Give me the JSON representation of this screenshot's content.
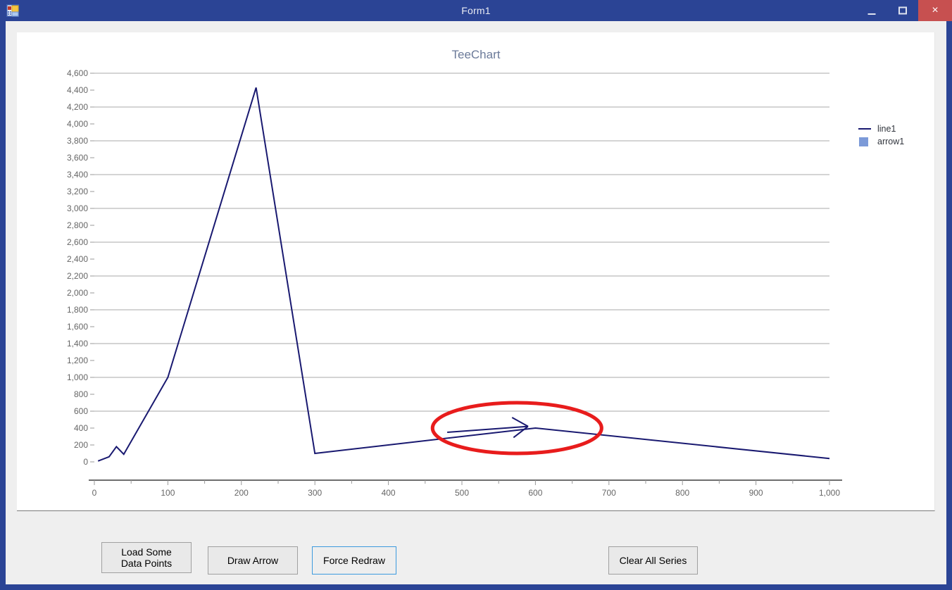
{
  "window": {
    "title": "Form1",
    "icon": "form-designer-icon",
    "minimize_label": "–",
    "maximize_label": "❐",
    "close_label": "×",
    "border_color": "#2b4495",
    "close_color": "#c75050"
  },
  "chart": {
    "title": "TeeChart",
    "title_color": "#6b7a99",
    "legend": [
      {
        "label": "line1",
        "marker": "line",
        "color": "#191970"
      },
      {
        "label": "arrow1",
        "marker": "square",
        "color": "#7c9ad8"
      }
    ]
  },
  "buttons": [
    {
      "name": "load-some-data-points-button",
      "label": "Load Some\nData Points",
      "focused": false
    },
    {
      "name": "draw-arrow-button",
      "label": "Draw Arrow",
      "focused": false
    },
    {
      "name": "force-redraw-button",
      "label": "Force Redraw",
      "focused": true
    },
    {
      "name": "clear-all-series-button",
      "label": "Clear All Series",
      "focused": false
    }
  ],
  "chart_data": {
    "type": "line",
    "title": "TeeChart",
    "xlabel": "",
    "ylabel": "",
    "xlim": [
      0,
      1000
    ],
    "ylim": [
      0,
      4600
    ],
    "grid": true,
    "grid_color": "#aaaaaa",
    "grid_y_step": 400,
    "legend_position": "right",
    "x_ticks": [
      0,
      100,
      200,
      300,
      400,
      500,
      600,
      700,
      800,
      900,
      1000
    ],
    "x_tick_labels": [
      "0",
      "100",
      "200",
      "300",
      "400",
      "500",
      "600",
      "700",
      "800",
      "900",
      "1,000"
    ],
    "x_minor_tick_step": 50,
    "y_ticks": [
      0,
      200,
      400,
      600,
      800,
      1000,
      1200,
      1400,
      1600,
      1800,
      2000,
      2200,
      2400,
      2600,
      2800,
      3000,
      3200,
      3400,
      3600,
      3800,
      4000,
      4200,
      4400,
      4600
    ],
    "y_tick_labels": [
      "0",
      "200",
      "400",
      "600",
      "800",
      "1,000",
      "1,200",
      "1,400",
      "1,600",
      "1,800",
      "2,000",
      "2,200",
      "2,400",
      "2,600",
      "2,800",
      "3,000",
      "3,200",
      "3,400",
      "3,600",
      "3,800",
      "4,000",
      "4,200",
      "4,400",
      "4,600"
    ],
    "y_gridline_values": [
      600,
      1000,
      1400,
      1800,
      2200,
      2600,
      3000,
      3400,
      3800,
      4200,
      4600
    ],
    "series": [
      {
        "name": "line1",
        "color": "#191970",
        "width": 2,
        "points": [
          [
            5,
            10
          ],
          [
            20,
            60
          ],
          [
            30,
            180
          ],
          [
            40,
            90
          ],
          [
            100,
            1000
          ],
          [
            220,
            4430
          ],
          [
            300,
            100
          ],
          [
            600,
            400
          ],
          [
            1000,
            40
          ]
        ]
      },
      {
        "name": "arrow1",
        "color": "#191970",
        "type": "arrow-annotation",
        "start": [
          480,
          350
        ],
        "end": [
          590,
          420
        ]
      }
    ],
    "annotations": [
      {
        "name": "red-highlight-ellipse",
        "type": "ellipse",
        "center_x": 575,
        "center_y": 400,
        "radius_x": 115,
        "radius_y": 300,
        "stroke": "#e81c1c",
        "stroke_width": 5
      }
    ]
  }
}
